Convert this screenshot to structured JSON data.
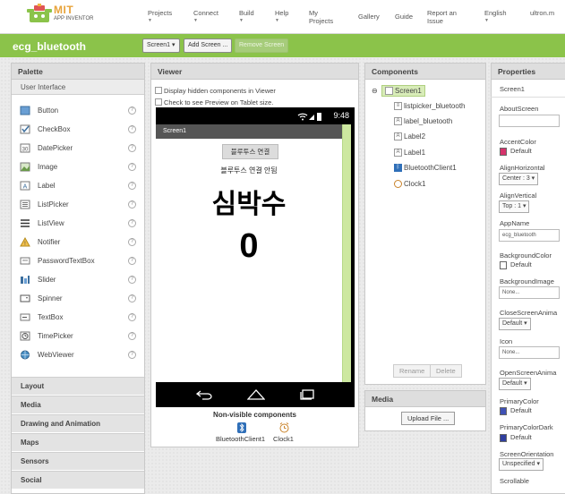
{
  "header": {
    "logo_title": "MIT",
    "logo_subtitle": "APP INVENTOR",
    "nav": [
      "Projects",
      "Connect",
      "Build",
      "Help",
      "My Projects",
      "Gallery",
      "Guide",
      "Report an Issue",
      "English",
      "ultron.m"
    ]
  },
  "project": {
    "name": "ecg_bluetooth",
    "screen_select": "Screen1",
    "add_screen": "Add Screen ...",
    "remove_screen": "Remove Screen"
  },
  "palette": {
    "title": "Palette",
    "category": "User Interface",
    "items": [
      "Button",
      "CheckBox",
      "DatePicker",
      "Image",
      "Label",
      "ListPicker",
      "ListView",
      "Notifier",
      "PasswordTextBox",
      "Slider",
      "Spinner",
      "TextBox",
      "TimePicker",
      "WebViewer"
    ],
    "drawers": [
      "Layout",
      "Media",
      "Drawing and Animation",
      "Maps",
      "Sensors",
      "Social"
    ]
  },
  "viewer": {
    "title": "Viewer",
    "hidden_components": "Display hidden components in Viewer",
    "tablet_preview": "Check to see Preview on Tablet size.",
    "status_time": "9:48",
    "screen_title": "Screen1",
    "button_label": "블루투스 연결",
    "status_text": "블루투스 연결 안됨",
    "heart_text": "심박수",
    "bpm_value": "0",
    "nonvisible_title": "Non-visible components",
    "nonvisible": [
      "BluetoothClient1",
      "Clock1"
    ]
  },
  "components": {
    "title": "Components",
    "tree": [
      "Screen1",
      "listpicker_bluetooth",
      "label_bluetooth",
      "Label2",
      "Label1",
      "BluetoothClient1",
      "Clock1"
    ],
    "rename": "Rename",
    "delete": "Delete"
  },
  "media": {
    "title": "Media",
    "upload": "Upload File ..."
  },
  "properties": {
    "title": "Properties",
    "screen": "Screen1",
    "about_screen": "AboutScreen",
    "accent_color": "AccentColor",
    "accent_value": "Default",
    "align_h": "AlignHorizontal",
    "align_h_value": "Center : 3 ▾",
    "align_v": "AlignVertical",
    "align_v_value": "Top : 1 ▾",
    "app_name": "AppName",
    "app_name_value": "ecg_bluetooth",
    "bg_color": "BackgroundColor",
    "bg_color_value": "Default",
    "bg_image": "BackgroundImage",
    "bg_image_value": "None...",
    "close_anim": "CloseScreenAnima",
    "close_anim_value": "Default ▾",
    "icon": "Icon",
    "icon_value": "None...",
    "open_anim": "OpenScreenAnima",
    "open_anim_value": "Default ▾",
    "primary_color": "PrimaryColor",
    "primary_color_value": "Default",
    "primary_dark": "PrimaryColorDark",
    "primary_dark_value": "Default",
    "orientation": "ScreenOrientation",
    "orientation_value": "Unspecified ▾",
    "scrollable": "Scrollable"
  },
  "colors": {
    "brand_green": "#8bc34a",
    "accent_swatch": "#d6336c",
    "primary_swatch": "#3f51b5",
    "primary_dark_swatch": "#303f9f"
  }
}
